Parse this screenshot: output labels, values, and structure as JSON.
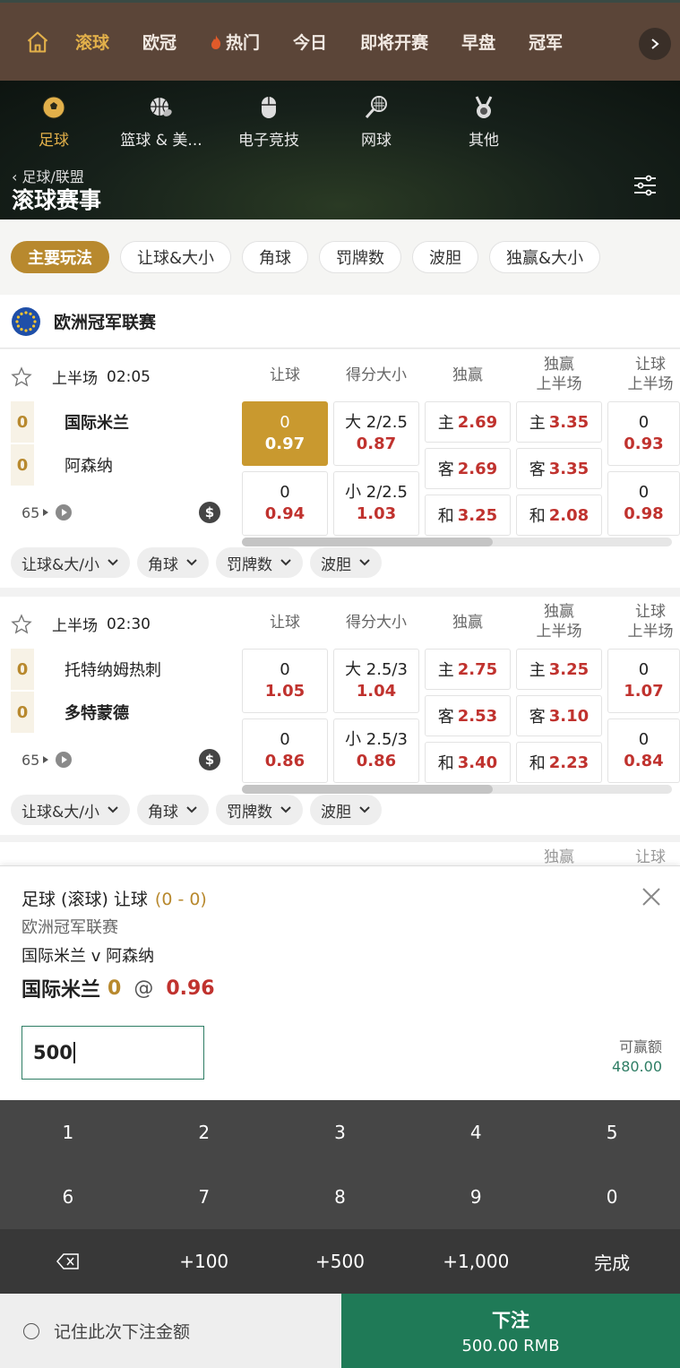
{
  "topnav": {
    "items": [
      "滚球",
      "欧冠",
      "热门",
      "今日",
      "即将开赛",
      "早盘",
      "冠军"
    ],
    "active_color": "#e2b04a"
  },
  "sports": [
    "足球",
    "篮球 & 美...",
    "电子竞技",
    "网球",
    "其他"
  ],
  "header": {
    "breadcrumb": "足球/联盟",
    "title": "滚球赛事"
  },
  "chips": [
    "主要玩法",
    "让球&大小",
    "角球",
    "罚牌数",
    "波胆",
    "独赢&大小"
  ],
  "league": {
    "name": "欧洲冠军联赛"
  },
  "columns": {
    "handicap": "让球",
    "ou": "得分大小",
    "winner": "独赢",
    "winner_half_a": "独赢",
    "winner_half_b": "上半场",
    "handicap_half_a": "让球",
    "handicap_half_b": "上半场"
  },
  "matches": [
    {
      "period": "上半场",
      "clock": "02:05",
      "home": {
        "score": "0",
        "name": "国际米兰"
      },
      "away": {
        "score": "0",
        "name": "阿森纳"
      },
      "markets_count": "65",
      "handicap": [
        {
          "line": "0",
          "odd": "0.97"
        },
        {
          "line": "0",
          "odd": "0.94"
        }
      ],
      "ou": [
        {
          "line": "大 2/2.5",
          "odd": "0.87"
        },
        {
          "line": "小 2/2.5",
          "odd": "1.03"
        }
      ],
      "winner": [
        {
          "label": "主",
          "odd": "2.69"
        },
        {
          "label": "客",
          "odd": "2.69"
        },
        {
          "label": "和",
          "odd": "3.25"
        }
      ],
      "winner_half": [
        {
          "label": "主",
          "odd": "3.35"
        },
        {
          "label": "客",
          "odd": "3.35"
        },
        {
          "label": "和",
          "odd": "2.08"
        }
      ],
      "handicap_half": [
        {
          "line": "0",
          "odd": "0.93"
        },
        {
          "line": "0",
          "odd": "0.98"
        }
      ],
      "chips": [
        "让球&大/小",
        "角球",
        "罚牌数",
        "波胆"
      ]
    },
    {
      "period": "上半场",
      "clock": "02:30",
      "home": {
        "score": "0",
        "name": "托特纳姆热刺"
      },
      "away": {
        "score": "0",
        "name": "多特蒙德"
      },
      "markets_count": "65",
      "handicap": [
        {
          "line": "0",
          "odd": "1.05"
        },
        {
          "line": "0",
          "odd": "0.86"
        }
      ],
      "ou": [
        {
          "line": "大 2.5/3",
          "odd": "1.04"
        },
        {
          "line": "小 2.5/3",
          "odd": "0.86"
        }
      ],
      "winner": [
        {
          "label": "主",
          "odd": "2.75"
        },
        {
          "label": "客",
          "odd": "2.53"
        },
        {
          "label": "和",
          "odd": "3.40"
        }
      ],
      "winner_half": [
        {
          "label": "主",
          "odd": "3.25"
        },
        {
          "label": "客",
          "odd": "3.10"
        },
        {
          "label": "和",
          "odd": "2.23"
        }
      ],
      "handicap_half": [
        {
          "line": "0",
          "odd": "1.07"
        },
        {
          "line": "0",
          "odd": "0.84"
        }
      ],
      "chips": [
        "让球&大/小",
        "角球",
        "罚牌数",
        "波胆"
      ]
    }
  ],
  "peek": {
    "winner_a": "独赢",
    "handicap_a": "让球"
  },
  "betslip": {
    "market": "足球 (滚球) 让球",
    "score": "(0 - 0)",
    "league": "欧洲冠军联赛",
    "fixture": "国际米兰 v 阿森纳",
    "selection": "国际米兰",
    "handicap": "0",
    "at": "@",
    "odds": "0.96",
    "stake": "500",
    "to_win_label": "可赢额",
    "to_win": "480.00"
  },
  "keypad": {
    "row1": [
      "1",
      "2",
      "3",
      "4",
      "5"
    ],
    "row2": [
      "6",
      "7",
      "8",
      "9",
      "0"
    ],
    "row3": [
      "+100",
      "+500",
      "+1,000",
      "完成"
    ]
  },
  "footer": {
    "remember": "记住此次下注金额",
    "place": "下注",
    "amount": "500.00 RMB"
  }
}
